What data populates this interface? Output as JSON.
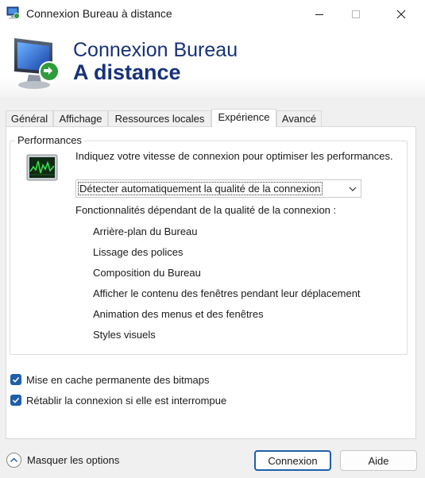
{
  "window": {
    "title": "Connexion Bureau à distance"
  },
  "banner": {
    "line1": "Connexion Bureau",
    "line2": "A distance"
  },
  "tabs": [
    {
      "label": "Général",
      "active": false
    },
    {
      "label": "Affichage",
      "active": false
    },
    {
      "label": "Ressources locales",
      "active": false
    },
    {
      "label": "Expérience",
      "active": true
    },
    {
      "label": "Avancé",
      "active": false
    }
  ],
  "performance": {
    "group_title": "Performances",
    "description": "Indiquez votre vitesse de connexion pour optimiser les performances.",
    "connection_select": {
      "selected": "Détecter automatiquement la qualité de la connexion"
    },
    "features_title": "Fonctionnalités dépendant de la qualité de la connexion :",
    "features": [
      "Arrière-plan du Bureau",
      "Lissage des polices",
      "Composition du Bureau",
      "Afficher le contenu des fenêtres pendant leur déplacement",
      "Animation des menus et des fenêtres",
      "Styles visuels"
    ]
  },
  "options": {
    "persistent_bitmap_cache": {
      "label": "Mise en cache permanente des bitmaps",
      "checked": true
    },
    "reconnect": {
      "label": "Rétablir la connexion si elle est interrompue",
      "checked": true
    }
  },
  "footer": {
    "toggle_label": "Masquer les options",
    "connect_label": "Connexion",
    "help_label": "Aide"
  },
  "colors": {
    "accent": "#1f5fa8",
    "banner_text": "#17327a"
  }
}
